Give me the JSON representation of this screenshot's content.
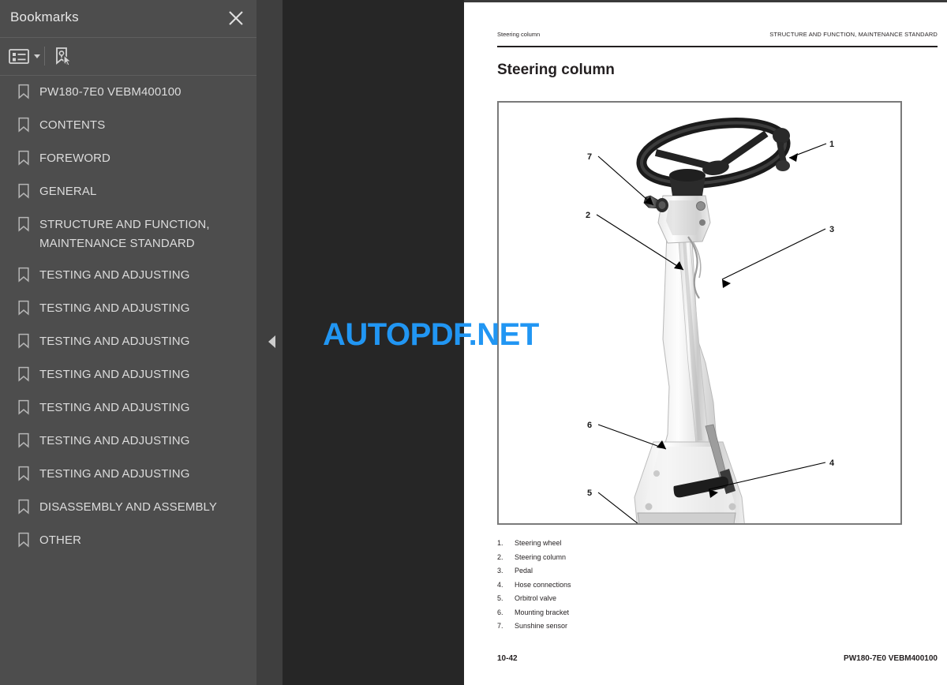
{
  "sidebar": {
    "title": "Bookmarks",
    "close_icon": "close-icon",
    "toolbar": {
      "options_icon": "list-options-icon",
      "caret_icon": "chevron-down-icon",
      "bookmark_tool_icon": "bookmark-pointer-icon"
    },
    "items": [
      {
        "icon": "bookmark-icon",
        "label": "PW180-7E0    VEBM400100"
      },
      {
        "icon": "bookmark-icon",
        "label": "CONTENTS"
      },
      {
        "icon": "bookmark-icon",
        "label": "FOREWORD"
      },
      {
        "icon": "bookmark-icon",
        "label": "GENERAL"
      },
      {
        "icon": "bookmark-icon",
        "label": "STRUCTURE AND FUNCTION,\nMAINTENANCE STANDARD"
      },
      {
        "icon": "bookmark-icon",
        "label": "TESTING AND ADJUSTING"
      },
      {
        "icon": "bookmark-icon",
        "label": "TESTING AND ADJUSTING"
      },
      {
        "icon": "bookmark-icon",
        "label": "TESTING AND ADJUSTING"
      },
      {
        "icon": "bookmark-icon",
        "label": "TESTING AND ADJUSTING"
      },
      {
        "icon": "bookmark-icon",
        "label": "TESTING AND ADJUSTING"
      },
      {
        "icon": "bookmark-icon",
        "label": "TESTING AND ADJUSTING"
      },
      {
        "icon": "bookmark-icon",
        "label": "TESTING AND ADJUSTING"
      },
      {
        "icon": "bookmark-icon",
        "label": "DISASSEMBLY AND ASSEMBLY"
      },
      {
        "icon": "bookmark-icon",
        "label": "OTHER"
      }
    ]
  },
  "viewer": {
    "collapse_icon": "collapse-panel-arrow-icon",
    "watermark": "AUTOPDF.NET",
    "watermark_color": "#2196f3"
  },
  "document": {
    "header_left": "Steering column",
    "header_right": "STRUCTURE AND FUNCTION, MAINTENANCE STANDARD",
    "title": "Steering column",
    "figure": {
      "callouts": [
        "1",
        "2",
        "3",
        "4",
        "5",
        "6",
        "7"
      ]
    },
    "parts": [
      {
        "num": "1.",
        "name": "Steering wheel"
      },
      {
        "num": "2.",
        "name": "Steering column"
      },
      {
        "num": "3.",
        "name": "Pedal"
      },
      {
        "num": "4.",
        "name": "Hose connections"
      },
      {
        "num": "5.",
        "name": "Orbitrol valve"
      },
      {
        "num": "6.",
        "name": "Mounting bracket"
      },
      {
        "num": "7.",
        "name": "Sunshine sensor"
      }
    ],
    "footer_left": "10-42",
    "footer_right": "PW180-7E0   VEBM400100"
  }
}
